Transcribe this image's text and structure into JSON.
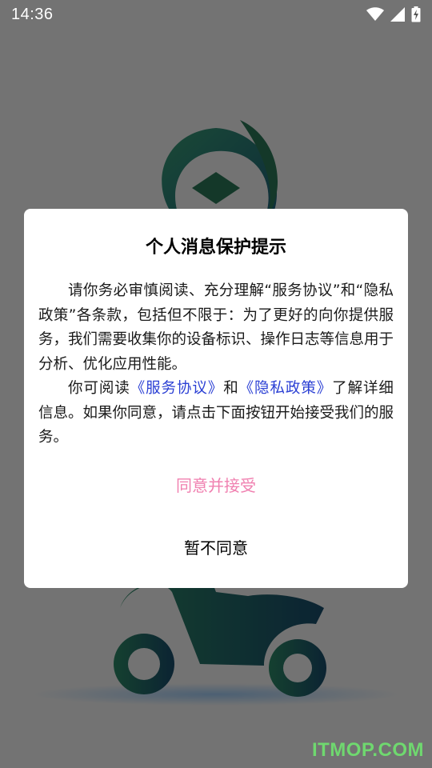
{
  "status_bar": {
    "time": "14:36",
    "icons": [
      "wifi-icon",
      "cellular-signal-icon",
      "battery-charging-icon"
    ]
  },
  "dialog": {
    "title": "个人消息保护提示",
    "paragraph1": "请你务必审慎阅读、充分理解“服务协议”和“隐私政策”各条款，包括但不限于：为了更好的向你提供服务，我们需要收集你的设备标识、操作日志等信息用于分析、优化应用性能。",
    "paragraph2_prefix": "你可阅读",
    "service_agreement_link": "《服务协议》",
    "paragraph2_and": "和",
    "privacy_policy_link": "《隐私政策》",
    "paragraph2_suffix": "了解详细信息。如果你同意，请点击下面按钮开始接受我们的服务。",
    "agree_label": "同意并接受",
    "disagree_label": "暂不同意"
  },
  "watermark": "ITMOP.COM",
  "colors": {
    "agree": "#f080b0",
    "link": "#2a3fd4",
    "logo_green": "#2e7d5b",
    "logo_blue": "#1d5f80"
  }
}
